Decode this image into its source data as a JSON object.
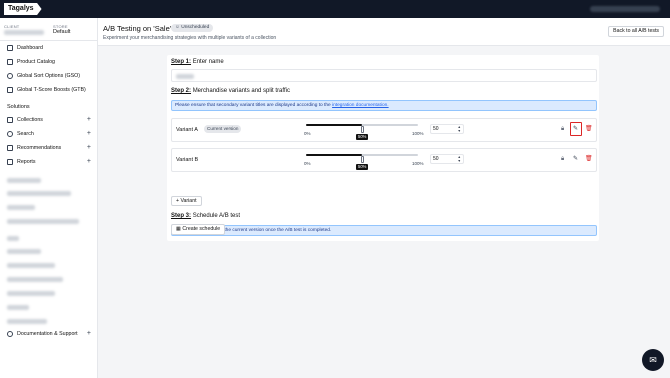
{
  "app": {
    "logo": "Tagalys"
  },
  "sidebar": {
    "client_label": "CLIENT",
    "store_label": "STORE",
    "store_value": "Default",
    "items": [
      {
        "label": "Dashboard",
        "icon": "dashboard-icon"
      },
      {
        "label": "Product Catalog",
        "icon": "catalog-icon"
      },
      {
        "label": "Global Sort Options (GSO)",
        "icon": "globe-icon"
      },
      {
        "label": "Global T-Score Boosts (GTB)",
        "icon": "trend-icon"
      }
    ],
    "solutions_title": "Solutions",
    "solutions": [
      {
        "label": "Collections",
        "icon": "collections-icon"
      },
      {
        "label": "Search",
        "icon": "search-icon"
      },
      {
        "label": "Recommendations",
        "icon": "recommendations-icon"
      },
      {
        "label": "Reports",
        "icon": "reports-icon"
      }
    ],
    "docs_label": "Documentation & Support"
  },
  "header": {
    "title": "A/B Testing on 'Sale'",
    "status_badge": "Unscheduled",
    "subtitle": "Experiment your merchandising strategies with multiple variants of a collection",
    "back_button": "Back to all A/B tests"
  },
  "step1": {
    "number": "Step 1:",
    "title": "Enter name"
  },
  "step2": {
    "number": "Step 2:",
    "title": "Merchandise variants and split traffic",
    "info_text": "Please ensure that secondary variant titles are displayed according to the",
    "info_link": "integration documentation."
  },
  "variants": [
    {
      "name": "Variant A",
      "badge": "Current version",
      "split_percent": 50,
      "tooltip": "50%",
      "min": "0%",
      "max": "100%",
      "value": "50"
    },
    {
      "name": "Variant B",
      "badge": "",
      "split_percent": 50,
      "tooltip": "50%",
      "min": "0%",
      "max": "100%",
      "value": "50"
    }
  ],
  "add_variant_button": "+ Variant",
  "step3": {
    "number": "Step 3:",
    "title": "Schedule A/B test",
    "info_text": "Traffic will be routed to the current version once the A/B test is completed.",
    "schedule_button": "Create schedule"
  },
  "colors": {
    "topbar": "#111827",
    "info_bg": "#dbeafe",
    "highlight": "#dc2626"
  }
}
